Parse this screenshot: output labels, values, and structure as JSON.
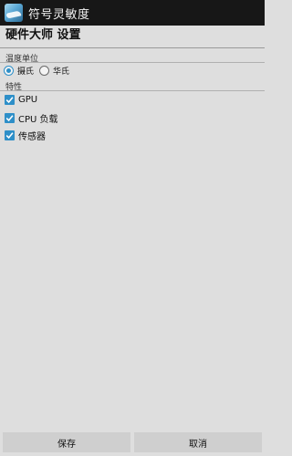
{
  "app": {
    "title": "符号灵敏度",
    "icon": "app-logo-icon"
  },
  "dialog": {
    "title": "硬件大师 设置"
  },
  "temperature": {
    "label": "温度单位",
    "options": [
      {
        "label": "摄氏",
        "checked": true
      },
      {
        "label": "华氏",
        "checked": false
      }
    ]
  },
  "features": {
    "label": "特性",
    "items": [
      {
        "label": "GPU",
        "checked": true
      },
      {
        "label": "CPU 负载",
        "checked": true
      },
      {
        "label": "传感器",
        "checked": true
      }
    ]
  },
  "buttons": {
    "save": "保存",
    "cancel": "取消"
  },
  "colors": {
    "accent": "#2e8fc8",
    "action_bar": "#171717",
    "background": "#dedede",
    "button": "#cfcfcf"
  }
}
